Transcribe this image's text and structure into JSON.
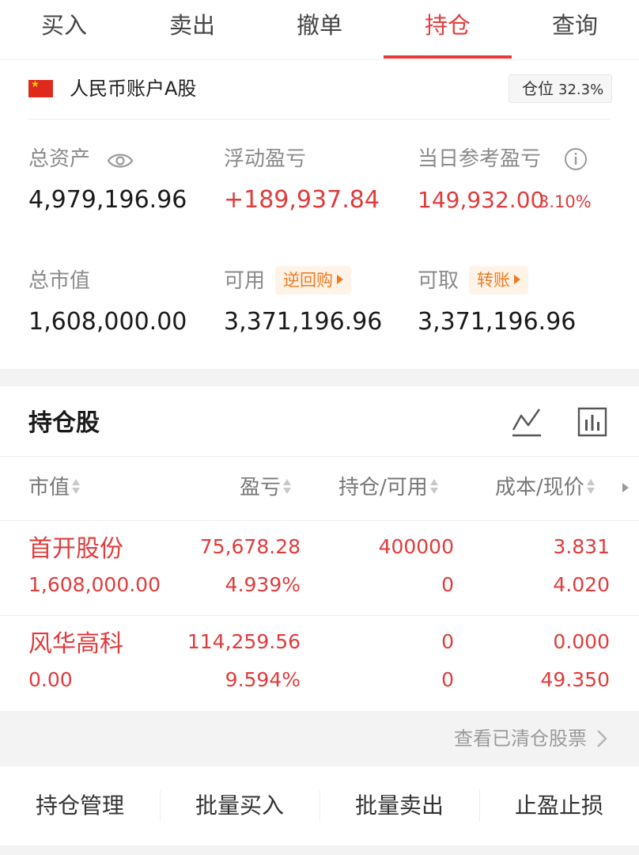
{
  "tabs": [
    {
      "label": "买入"
    },
    {
      "label": "卖出"
    },
    {
      "label": "撤单"
    },
    {
      "label": "持仓"
    },
    {
      "label": "查询"
    }
  ],
  "active_tab": "持仓",
  "account": {
    "name": "人民币账户A股",
    "position_label": "仓位",
    "position_pct": "32.3%"
  },
  "summary": {
    "total_assets_label": "总资产",
    "total_assets": "4,979,196.96",
    "floating_pnl_label": "浮动盈亏",
    "floating_pnl": "+189,937.84",
    "daily_pnl_label": "当日参考盈亏",
    "daily_pnl": "149,932.00",
    "daily_pnl_pct": "3.10%",
    "market_value_label": "总市值",
    "market_value": "1,608,000.00",
    "available_label": "可用",
    "available_link": "逆回购",
    "available": "3,371,196.96",
    "withdrawable_label": "可取",
    "withdrawable_link": "转账",
    "withdrawable": "3,371,196.96"
  },
  "holdings": {
    "title": "持仓股",
    "columns": [
      "市值",
      "盈亏",
      "持仓/可用",
      "成本/现价"
    ],
    "rows": [
      {
        "name": "首开股份",
        "market_value": "1,608,000.00",
        "pnl": "75,678.28",
        "pnl_pct": "4.939%",
        "position": "400000",
        "available": "0",
        "cost": "3.831",
        "price": "4.020"
      },
      {
        "name": "风华高科",
        "market_value": "0.00",
        "pnl": "114,259.56",
        "pnl_pct": "9.594%",
        "position": "0",
        "available": "0",
        "cost": "0.000",
        "price": "49.350"
      }
    ]
  },
  "cleared_link": "查看已清仓股票",
  "bottom_actions": [
    "持仓管理",
    "批量买入",
    "批量卖出",
    "止盈止损"
  ],
  "colors": {
    "accent_red": "#e63b3b",
    "link_orange": "#f07a1e",
    "muted_gray": "#8a8a8a"
  },
  "icons": {
    "visibility": "eye-icon",
    "info": "info-icon",
    "trend": "trend-line-icon",
    "chart": "bar-chart-icon",
    "flag": "china-flag-icon"
  }
}
